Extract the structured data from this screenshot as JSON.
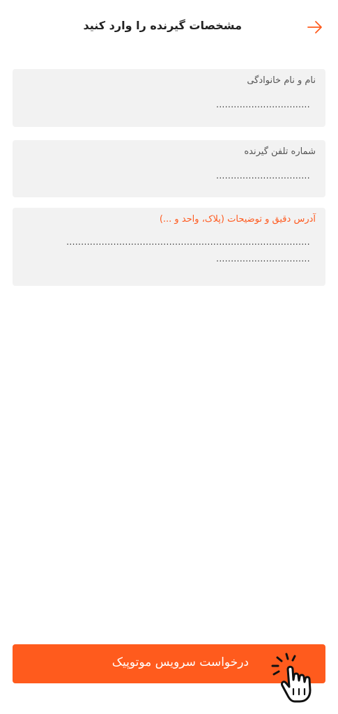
{
  "header": {
    "title": "مشخصات گیرنده را وارد کنید",
    "back_icon": "arrow-right-icon"
  },
  "form": {
    "name_field": {
      "label": "نام و نام خانوادگی",
      "placeholder": "................................"
    },
    "phone_field": {
      "label": "شماره تلفن گیرنده",
      "placeholder": "................................"
    },
    "address_field": {
      "label": "آدرس دقیق و توضیحات (پلاک، واحد و ...)",
      "placeholder_line1": "...................................................................................",
      "placeholder_line2": "................................"
    }
  },
  "footer": {
    "submit_label": "درخواست سرویس موتوپیک",
    "tap_icon": "hand-tap-icon"
  },
  "colors": {
    "accent": "#ff5b1d",
    "field_bg": "#f2f2f2",
    "title": "#222222"
  }
}
